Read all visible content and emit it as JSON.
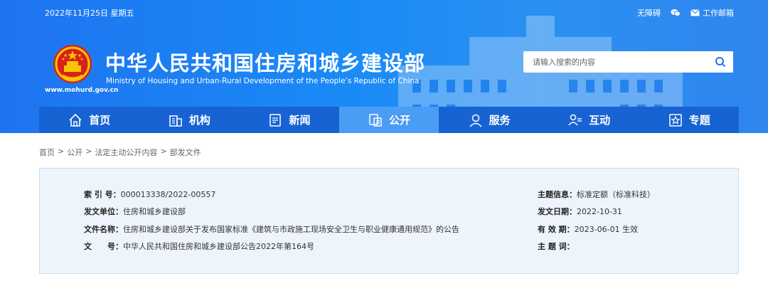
{
  "topbar": {
    "date": "2022年11月25日 星期五",
    "accessibility": "无障碍",
    "email": "工作邮箱"
  },
  "site": {
    "url": "www.mohurd.gov.cn",
    "title_zh": "中华人民共和国住房和城乡建设部",
    "title_en": "Ministry of Housing and Urban-Rural Development of the People’s Republic of China"
  },
  "search": {
    "placeholder": "请输入搜索的内容"
  },
  "nav": {
    "items": [
      {
        "label": "首页",
        "icon": "home-icon"
      },
      {
        "label": "机构",
        "icon": "building-icon"
      },
      {
        "label": "新闻",
        "icon": "news-icon"
      },
      {
        "label": "公开",
        "icon": "disclosure-icon",
        "active": true
      },
      {
        "label": "服务",
        "icon": "service-icon"
      },
      {
        "label": "互动",
        "icon": "interact-icon"
      },
      {
        "label": "专题",
        "icon": "topic-icon"
      }
    ]
  },
  "breadcrumb": {
    "items": [
      "首页",
      "公开",
      "法定主动公开内容",
      "部发文件"
    ],
    "separator": ">"
  },
  "info": {
    "index_label": "索 引 号：",
    "index_value": "000013338/2022-00557",
    "issuer_label": "发文单位：",
    "issuer_value": "住房和城乡建设部",
    "name_label": "文件名称：",
    "name_value": "住房和城乡建设部关于发布国家标准《建筑与市政施工现场安全卫生与职业健康通用规范》的公告",
    "docno_label": "文　　号：",
    "docno_value": "中华人民共和国住房和城乡建设部公告2022年第164号",
    "topic_label": "主题信息：",
    "topic_value": "标准定额（标准科技）",
    "date_label": "发文日期：",
    "date_value": "2022-10-31",
    "valid_label": "有 效 期：",
    "valid_value": "2023-06-01 生效",
    "keyword_label": "主 题 词："
  },
  "colors": {
    "header_blue": "#1e74f0",
    "nav_blue": "#1763d4",
    "nav_active": "#4a9cf5",
    "info_bg": "#eef4fb"
  }
}
